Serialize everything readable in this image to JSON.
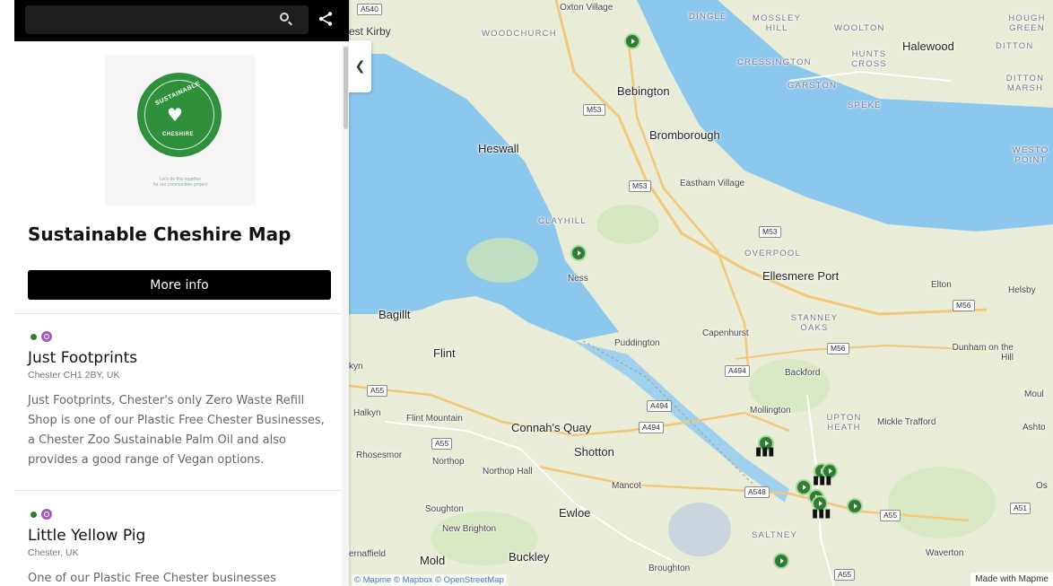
{
  "search": {
    "placeholder": "",
    "search_icon": "search-icon",
    "share_icon": "share-icon"
  },
  "brand": {
    "logo_top": "SUSTAINABLE",
    "logo_bottom": "CHESHIRE",
    "logo_tagline_1": "Let's do this together",
    "logo_tagline_2": "for our communities project"
  },
  "title": "Sustainable Cheshire Map",
  "more_info": "More info",
  "items": [
    {
      "name": "Just Footprints",
      "location": "Chester CH1 2BY, UK",
      "description": "Just Footprints, Chester's only Zero Waste Refill Shop is one of our Plastic Free Chester Businesses, a Chester Zoo Sustainable Palm Oil and also provides a good range of Vegan options."
    },
    {
      "name": "Little Yellow Pig",
      "location": "Chester, UK",
      "description": "One of our Plastic Free Chester businesses"
    }
  ],
  "map": {
    "collapse_icon": "chevron-left-icon",
    "places": {
      "oxton": "Oxton Village",
      "west_kirby": "est Kirby",
      "woodchurch": "WOODCHURCH",
      "dingle": "DINGLE",
      "mossley_hill": "MOSSLEY HILL",
      "woolton": "WOOLTON",
      "hough_green": "HOUGH GREEN",
      "halewood": "Halewood",
      "ditton": "DITTON",
      "cressington": "CRESSINGTON",
      "hunts_cross": "HUNTS CROSS",
      "ditton_marsh": "DITTON MARSH",
      "bebington": "Bebington",
      "garston": "GARSTON",
      "speke": "SPEKE",
      "bromborough": "Bromborough",
      "heswall": "Heswall",
      "weston_point": "WESTO POINT",
      "eastham": "Eastham Village",
      "clayhill": "CLAYHILL",
      "overpool": "OVERPOOL",
      "ness": "Ness",
      "ellesmere_port": "Ellesmere Port",
      "elton": "Elton",
      "helsby": "Helsby",
      "bagillt": "Bagillt",
      "stanney_oaks": "STANNEY OAKS",
      "puddington": "Puddington",
      "capenhurst": "Capenhurst",
      "flint": "Flint",
      "dunham": "Dunham on the Hill",
      "backford": "Backford",
      "kyn": "kyn",
      "moul": "Moul",
      "halkyn": "Halkyn",
      "flint_mountain": "Flint Mountain",
      "connahs_quay": "Connah's Quay",
      "mollington": "Mollington",
      "upton_heath": "UPTON HEATH",
      "mickle_trafford": "Mickle Trafford",
      "ashto": "Ashto",
      "rhosesmor": "Rhosesmor",
      "northop": "Northop",
      "northop_hall": "Northop Hall",
      "shotton": "Shotton",
      "mancot": "Mancot",
      "os": "Os",
      "soughton": "Soughton",
      "ewloe": "Ewloe",
      "new_brighton": "New Brighton",
      "saltney": "SALTNEY",
      "ernaffield": "ernaffield",
      "mold": "Mold",
      "buckley": "Buckley",
      "broughton": "Broughton",
      "waverton": "Waverton"
    },
    "roads": {
      "a540": "A540",
      "m53_1": "M53",
      "m53_2": "M53",
      "m53_3": "M53",
      "m56_1": "M56",
      "m56_2": "M56",
      "a494_1": "A494",
      "a494_2": "A494",
      "a494_3": "A494",
      "a55_1": "A55",
      "a55_2": "A55",
      "a548": "A548",
      "a55_3": "A55",
      "a51": "A51",
      "a55_4": "A55"
    },
    "attribution": "© Mapme © Mapbox © OpenStreetMap",
    "made_with": "Made with Mapme"
  }
}
